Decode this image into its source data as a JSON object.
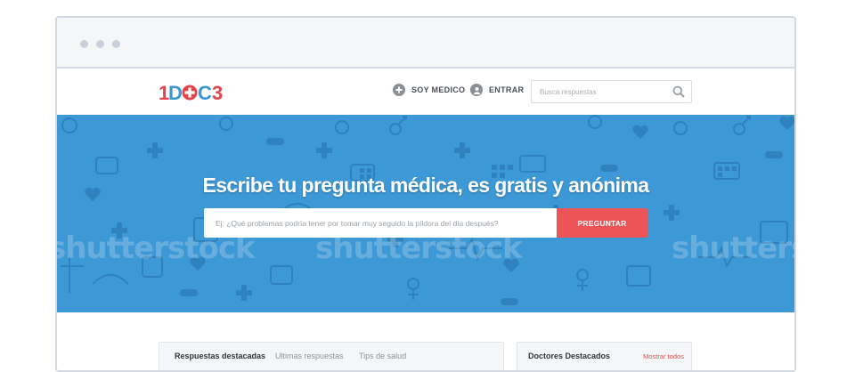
{
  "browser": {
    "dots": [
      "dot",
      "dot",
      "dot"
    ]
  },
  "header": {
    "logo": {
      "part1": "1",
      "part2": "D",
      "part3": "+",
      "part4": "C3",
      "full": "1DOC3"
    },
    "soy_medico": "SOY MEDICO",
    "entrar": "ENTRAR",
    "search_placeholder": "Busca respuestas",
    "icons": {
      "soy_medico": "plus-circle-icon",
      "entrar": "user-circle-icon",
      "search": "search-icon"
    }
  },
  "hero": {
    "title": "Escribe tu pregunta médica, es gratis y anónima",
    "input_placeholder": "Ej: ¿Qué problemas podría tener por tomar muy seguido la píldora del día después?",
    "button_label": "PREGUNTAR",
    "watermark": "shutterstock"
  },
  "content": {
    "tabs": [
      {
        "label": "Respuestas destacadas"
      },
      {
        "label": "Ultimas respuestas"
      },
      {
        "label": "Tips de salud"
      }
    ],
    "doctors_title": "Doctores Destacados",
    "show_all": "Mostrar todos"
  },
  "colors": {
    "hero_bg": "#3d98d6",
    "accent_red": "#ec5458",
    "logo_red": "#e8424b",
    "logo_blue": "#3a97d4"
  }
}
